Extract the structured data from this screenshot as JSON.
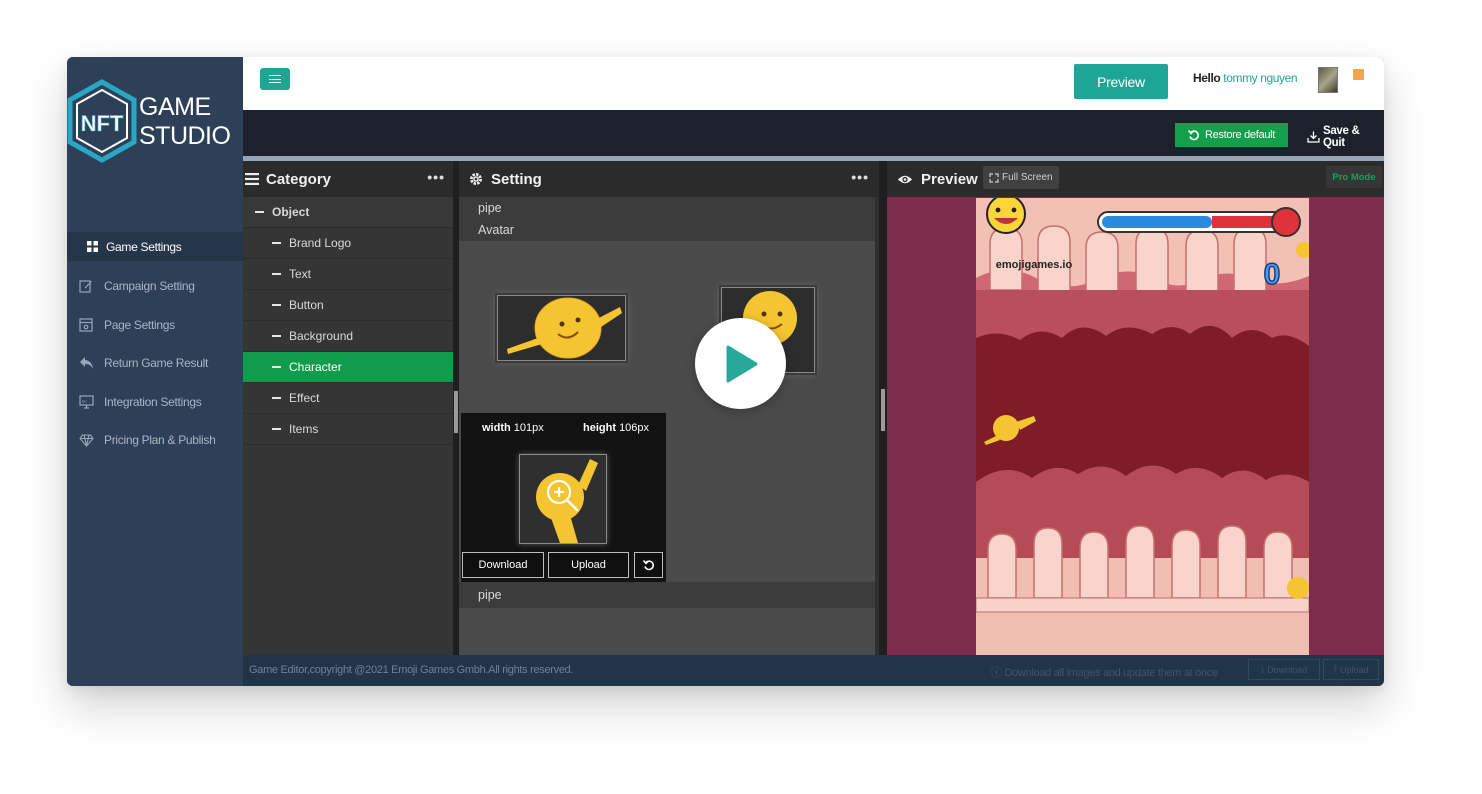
{
  "brand": {
    "logo_letters": "NFT",
    "line1": "GAME",
    "line2": "STUDIO"
  },
  "sidebar": {
    "items": [
      {
        "label": "Game Settings",
        "icon": "grid-icon",
        "active": true
      },
      {
        "label": "Campaign Setting",
        "icon": "edit-icon"
      },
      {
        "label": "Page Settings",
        "icon": "page-settings-icon"
      },
      {
        "label": "Return Game Result",
        "icon": "reply-icon"
      },
      {
        "label": "Integration Settings",
        "icon": "monitor-icon"
      },
      {
        "label": "Pricing Plan & Publish",
        "icon": "diamond-icon"
      }
    ]
  },
  "header": {
    "preview_label": "Preview",
    "hello_label": "Hello",
    "user_name": "tommy nguyen"
  },
  "toolbar": {
    "restore_label": "Restore default",
    "save_quit_label": "Save & Quit"
  },
  "category_panel": {
    "title": "Category",
    "menu_glyph": "•••",
    "items": [
      {
        "label": "Object",
        "level": 0
      },
      {
        "label": "Brand Logo",
        "level": 1
      },
      {
        "label": "Text",
        "level": 1
      },
      {
        "label": "Button",
        "level": 1
      },
      {
        "label": "Background",
        "level": 1
      },
      {
        "label": "Character",
        "level": 1,
        "active": true
      },
      {
        "label": "Effect",
        "level": 1
      },
      {
        "label": "Items",
        "level": 1
      }
    ]
  },
  "setting_panel": {
    "title": "Setting",
    "menu_glyph": "•••",
    "group_label_top": "pipe",
    "avatar_label": "Avatar",
    "group_label_bottom": "pipe",
    "selected": {
      "width_label": "width",
      "width_value": "101px",
      "height_label": "height",
      "height_value": "106px",
      "download_label": "Download",
      "upload_label": "Upload"
    }
  },
  "preview_panel": {
    "title": "Preview",
    "fullscreen_label": "Full Screen",
    "pro_mode_label": "Pro Mode",
    "game": {
      "brand_text": "emojigames.io",
      "score": "0"
    }
  },
  "footer": {
    "copyright": "Game Editor,copyright @2021 Emoji Games Gmbh.All rights reserved.",
    "download_all_text": "Download all images and update them at once",
    "download_label": "Download",
    "upload_label": "Upload"
  },
  "colors": {
    "accent_teal": "#1fa596",
    "success_green": "#12a04c",
    "sidebar_bg": "#2e4058",
    "preview_bg": "#7d2d4a",
    "notification": "#f0a849"
  }
}
